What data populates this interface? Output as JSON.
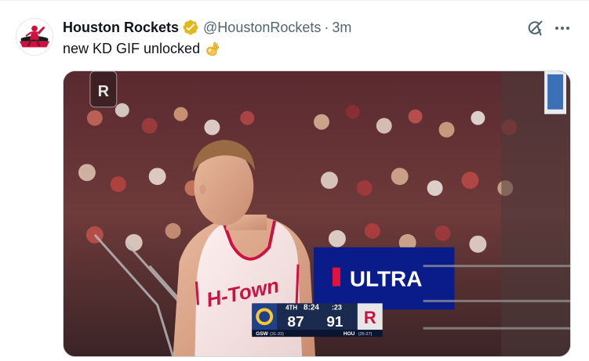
{
  "tweet": {
    "display_name": "Houston Rockets",
    "handle": "@HoustonRockets",
    "separator": "·",
    "timestamp": "3m",
    "text": "new KD GIF unlocked"
  },
  "icons": {
    "avatar": "houston-rockets-logo-avatar",
    "verified": "verified-gold-badge-icon",
    "grok": "grok-icon",
    "more": "more-horizontal-icon",
    "emoji": "ok-hand-emoji"
  },
  "media": {
    "type": "gif",
    "banner_text": "ULTRA",
    "jersey_text": "H-Town",
    "scoreboard": {
      "away_team": "GSW",
      "away_record": "(31-33)",
      "away_score": "87",
      "home_team": "HOU",
      "home_record": "(35-27)",
      "home_score": "91",
      "quarter": "4TH",
      "clock": "8:24",
      "shot_clock": ":23"
    }
  },
  "colors": {
    "text_primary": "#0f1419",
    "text_secondary": "#536471",
    "verified_gold": "#e2b719",
    "rockets_red": "#ce1141",
    "warriors_blue": "#1d428a",
    "warriors_gold": "#ffc72c"
  }
}
